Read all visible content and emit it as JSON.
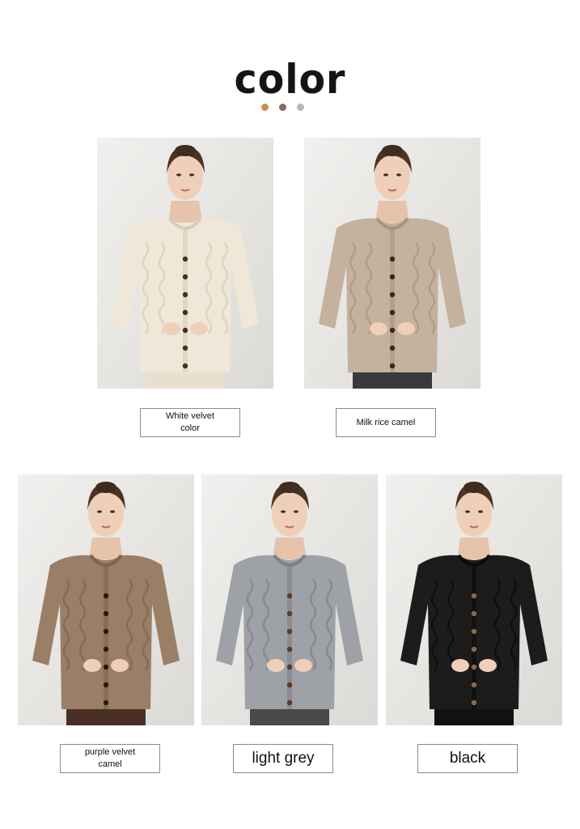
{
  "header": {
    "title": "color",
    "dot_colors": [
      "#c98d52",
      "#8a6a62",
      "#bdb8b2"
    ]
  },
  "swatches": [
    {
      "label": "White velvet\ncolor",
      "sweater_color": "#efe8d8",
      "sweater_shadow": "#d6cdb8",
      "bottom_color": "#e9dfcf",
      "button_color": "#4a2e1c"
    },
    {
      "label": "Milk rice camel",
      "sweater_color": "#c4b29e",
      "sweater_shadow": "#a8947e",
      "bottom_color": "#3a3a3a",
      "button_color": "#3b261a"
    },
    {
      "label": "purple velvet\ncamel",
      "sweater_color": "#9a7f66",
      "sweater_shadow": "#7c644e",
      "bottom_color": "#4a3024",
      "button_color": "#2b1a12"
    },
    {
      "label": "light grey",
      "sweater_color": "#9ea1a5",
      "sweater_shadow": "#7e8186",
      "bottom_color": "#4a4a4a",
      "button_color": "#5a3a26"
    },
    {
      "label": "black",
      "sweater_color": "#1c1c1c",
      "sweater_shadow": "#0a0a0a",
      "bottom_color": "#111111",
      "button_color": "#8a6a4a"
    }
  ]
}
